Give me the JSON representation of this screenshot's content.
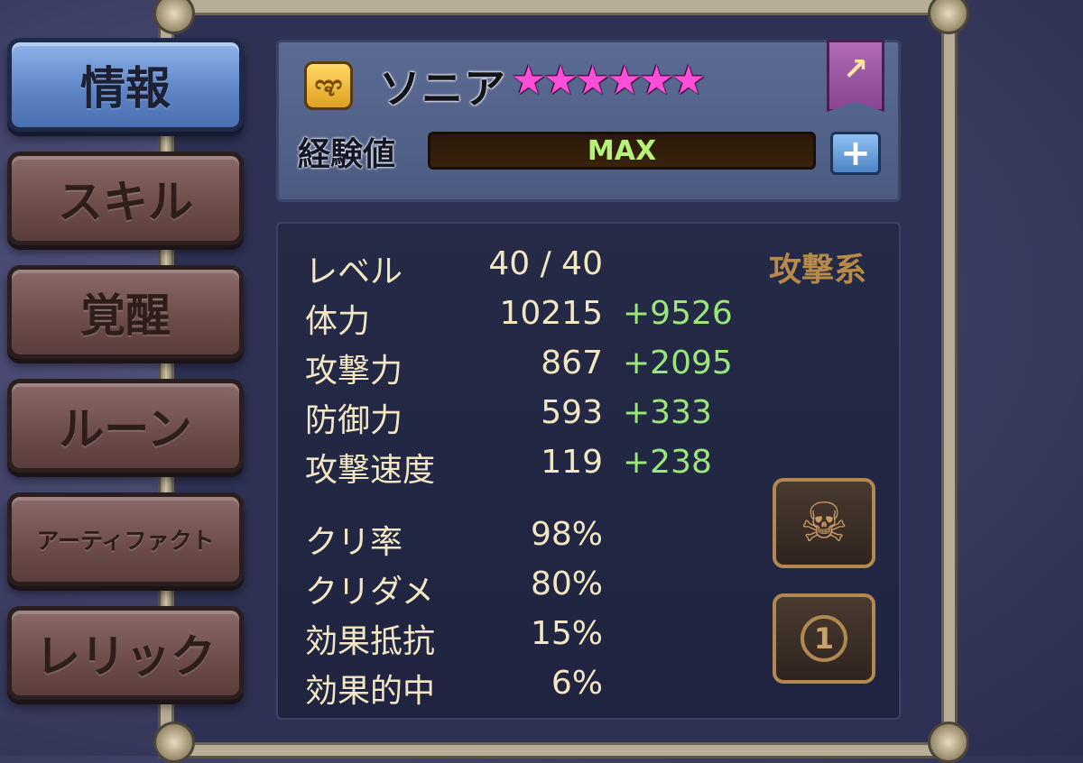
{
  "tabs": [
    {
      "label": "情報"
    },
    {
      "label": "スキル"
    },
    {
      "label": "覚醒"
    },
    {
      "label": "ルーン"
    },
    {
      "label": "アーティファクト"
    },
    {
      "label": "レリック"
    }
  ],
  "monster": {
    "name": "ソニア",
    "stars": 6,
    "star_glyphs": "★★★★★★",
    "element_icon": "wind-element-icon",
    "element_glyph": "ಞ",
    "exp_label": "経験値",
    "exp_value": "MAX",
    "type": "攻撃系"
  },
  "stats": {
    "level": {
      "label": "レベル",
      "value": "40 / 40"
    },
    "hp": {
      "label": "体力",
      "value": "10215",
      "bonus": "+9526"
    },
    "atk": {
      "label": "攻撃力",
      "value": "867",
      "bonus": "+2095"
    },
    "def": {
      "label": "防御力",
      "value": "593",
      "bonus": "+333"
    },
    "spd": {
      "label": "攻撃速度",
      "value": "119",
      "bonus": "+238"
    },
    "crit_rate": {
      "label": "クリ率",
      "value": "98%"
    },
    "crit_dmg": {
      "label": "クリダメ",
      "value": "80%"
    },
    "resistance": {
      "label": "効果抵抗",
      "value": "15%"
    },
    "accuracy": {
      "label": "効果的中",
      "value": "6%"
    }
  },
  "side_buttons": {
    "skill_icon": "skull-helmet-icon",
    "badge_number": "1"
  },
  "colors": {
    "active_tab": "#5f86c8",
    "inactive_tab": "#6d4c4a",
    "stat_text": "#f3e6c2",
    "bonus_text": "#9be67a",
    "star": "#ff4fd8",
    "exp_text": "#b6f27a"
  }
}
